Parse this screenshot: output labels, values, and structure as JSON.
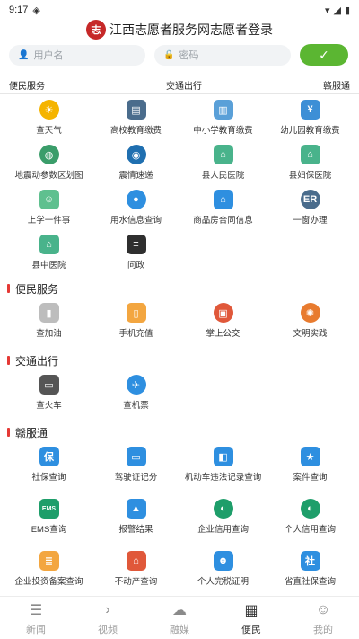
{
  "status": {
    "time": "9:17",
    "left_icon": "android-icon",
    "right_icons": [
      "wifi-icon",
      "signal-icon",
      "battery-icon"
    ]
  },
  "header": {
    "logo_text": "志",
    "title": "江西志愿者服务网志愿者登录"
  },
  "login": {
    "username_placeholder": "用户名",
    "password_placeholder": "密码",
    "submit_symbol": "✓"
  },
  "top_tabs": [
    "便民服务",
    "交通出行",
    "赣服通"
  ],
  "top_grid": [
    {
      "label": "查天气",
      "icon": "weather-icon",
      "symbol": "☀",
      "color": "#f5b400",
      "round": true
    },
    {
      "label": "高校教育缴费",
      "icon": "graduation-icon",
      "symbol": "▤",
      "color": "#4a6c8c",
      "round": false
    },
    {
      "label": "中小学教育缴费",
      "icon": "school-fee-icon",
      "symbol": "▥",
      "color": "#5aa0d8",
      "round": false
    },
    {
      "label": "幼儿园教育缴费",
      "icon": "kindergarten-fee-icon",
      "symbol": "¥",
      "color": "#3d8fd6",
      "round": false
    },
    {
      "label": "地震动参数区划图",
      "icon": "globe-icon",
      "symbol": "◍",
      "color": "#3a9d6a",
      "round": true
    },
    {
      "label": "震情速递",
      "icon": "earth-icon",
      "symbol": "◉",
      "color": "#1f6fb0",
      "round": true
    },
    {
      "label": "县人民医院",
      "icon": "hospital-icon",
      "symbol": "⌂",
      "color": "#49b38b",
      "round": false
    },
    {
      "label": "县妇保医院",
      "icon": "maternal-hospital-icon",
      "symbol": "⌂",
      "color": "#49b38b",
      "round": false
    },
    {
      "label": "上学一件事",
      "icon": "student-icon",
      "symbol": "☺",
      "color": "#5fc08f",
      "round": false
    },
    {
      "label": "用水信息查询",
      "icon": "water-drop-icon",
      "symbol": "●",
      "color": "#2e8fe0",
      "round": true
    },
    {
      "label": "商品房合同信息",
      "icon": "house-icon",
      "symbol": "⌂",
      "color": "#2e8fe0",
      "round": false
    },
    {
      "label": "一窗办理",
      "icon": "window-service-icon",
      "symbol": "ER",
      "color": "#4a6c8c",
      "round": true
    },
    {
      "label": "县中医院",
      "icon": "tcm-hospital-icon",
      "symbol": "⌂",
      "color": "#49b38b",
      "round": false
    },
    {
      "label": "问政",
      "icon": "inquiry-icon",
      "symbol": "≡",
      "color": "#2f2f2f",
      "round": false
    }
  ],
  "sections": [
    {
      "title": "便民服务",
      "items": [
        {
          "label": "查加油",
          "icon": "gas-station-icon",
          "symbol": "▮",
          "color": "#bdbdbd",
          "round": false
        },
        {
          "label": "手机充值",
          "icon": "phone-recharge-icon",
          "symbol": "▯",
          "color": "#f3a640",
          "round": false
        },
        {
          "label": "掌上公交",
          "icon": "bus-icon",
          "symbol": "▣",
          "color": "#e0583a",
          "round": true
        },
        {
          "label": "文明实践",
          "icon": "civilization-icon",
          "symbol": "✺",
          "color": "#e87b2f",
          "round": true
        }
      ]
    },
    {
      "title": "交通出行",
      "items": [
        {
          "label": "查火车",
          "icon": "train-icon",
          "symbol": "▭",
          "color": "#555555",
          "round": false
        },
        {
          "label": "查机票",
          "icon": "airplane-icon",
          "symbol": "✈",
          "color": "#2e8fe0",
          "round": true
        }
      ]
    },
    {
      "title": "赣服通",
      "items": [
        {
          "label": "社保查询",
          "icon": "social-security-icon",
          "symbol": "保",
          "color": "#2e8fe0",
          "round": false
        },
        {
          "label": "驾驶证记分",
          "icon": "license-icon",
          "symbol": "▭",
          "color": "#2e8fe0",
          "round": false
        },
        {
          "label": "机动车违法记录查询",
          "icon": "car-violation-icon",
          "symbol": "◧",
          "color": "#2e8fe0",
          "round": false
        },
        {
          "label": "案件查询",
          "icon": "police-badge-icon",
          "symbol": "★",
          "color": "#2e8fe0",
          "round": false
        },
        {
          "label": "EMS查询",
          "icon": "ems-icon",
          "symbol": "EMS",
          "color": "#1e9e6a",
          "round": false
        },
        {
          "label": "报警结果",
          "icon": "alarm-icon",
          "symbol": "▲",
          "color": "#2e8fe0",
          "round": false
        },
        {
          "label": "企业信用查询",
          "icon": "enterprise-credit-icon",
          "symbol": "◐",
          "color": "#1e9e6a",
          "round": true
        },
        {
          "label": "个人信用查询",
          "icon": "personal-credit-icon",
          "symbol": "◐",
          "color": "#1e9e6a",
          "round": true
        },
        {
          "label": "企业投资备案查询",
          "icon": "investment-icon",
          "symbol": "≣",
          "color": "#f3a640",
          "round": false
        },
        {
          "label": "不动产查询",
          "icon": "real-estate-icon",
          "symbol": "⌂",
          "color": "#e0583a",
          "round": false
        },
        {
          "label": "个人完税证明",
          "icon": "tax-certificate-icon",
          "symbol": "☻",
          "color": "#2e8fe0",
          "round": false
        },
        {
          "label": "省直社保查询",
          "icon": "provincial-social-icon",
          "symbol": "社",
          "color": "#2e8fe0",
          "round": false
        }
      ]
    }
  ],
  "bottom_nav": [
    {
      "label": "新闻",
      "icon": "news-icon",
      "symbol": "☰",
      "active": false
    },
    {
      "label": "视频",
      "icon": "video-icon",
      "symbol": "›",
      "active": false
    },
    {
      "label": "融媒",
      "icon": "cloud-icon",
      "symbol": "☁",
      "active": false
    },
    {
      "label": "便民",
      "icon": "grid-apps-icon",
      "symbol": "▦",
      "active": true
    },
    {
      "label": "我的",
      "icon": "profile-icon",
      "symbol": "☺",
      "active": false
    }
  ],
  "colors": {
    "accent_green": "#5bb632",
    "section_bar": "#e53935",
    "logo_red": "#c62828"
  }
}
